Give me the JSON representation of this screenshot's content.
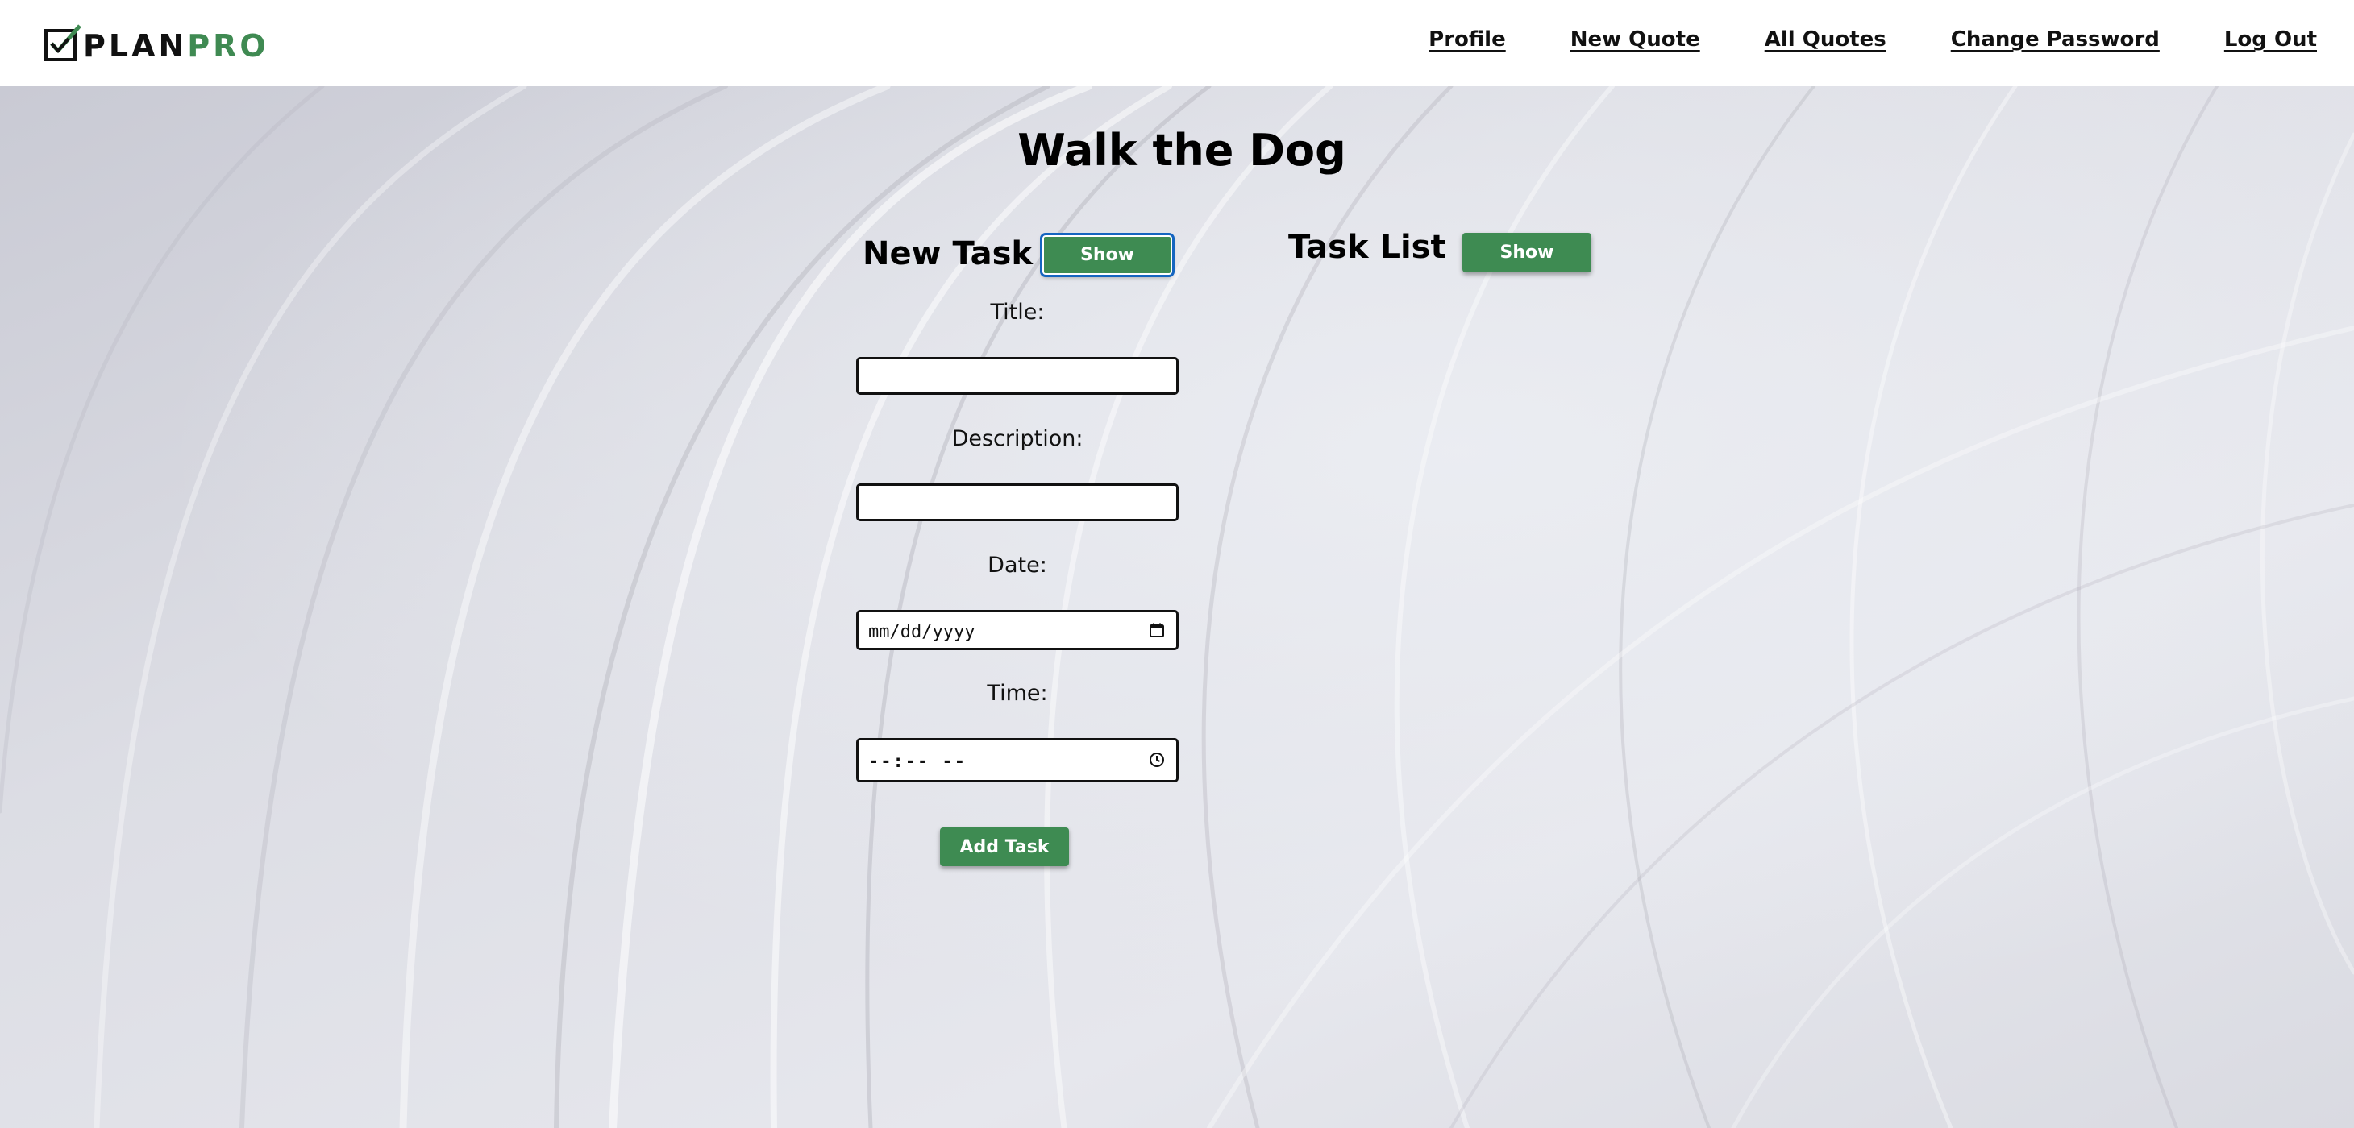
{
  "nav": {
    "logo": {
      "plan": "PLAN",
      "pro": "PRO"
    },
    "links": [
      "Profile",
      "New Quote",
      "All Quotes",
      "Change Password",
      "Log Out"
    ]
  },
  "page": {
    "title": "Walk the Dog"
  },
  "new_task": {
    "heading": "New Task",
    "show_label": "Show",
    "fields": {
      "title_label": "Title:",
      "title_value": "",
      "description_label": "Description:",
      "description_value": "",
      "date_label": "Date:",
      "date_placeholder": "mm/dd/yyyy",
      "time_label": "Time:",
      "time_placeholder": "--:-- --"
    },
    "submit_label": "Add Task"
  },
  "task_list": {
    "heading": "Task List",
    "show_label": "Show"
  },
  "colors": {
    "accent_green": "#3e8b52",
    "logo_green": "#3f8a52",
    "focus_ring": "#1565c0"
  },
  "icons": [
    "checkmark-logo-icon",
    "calendar-icon",
    "clock-icon"
  ]
}
